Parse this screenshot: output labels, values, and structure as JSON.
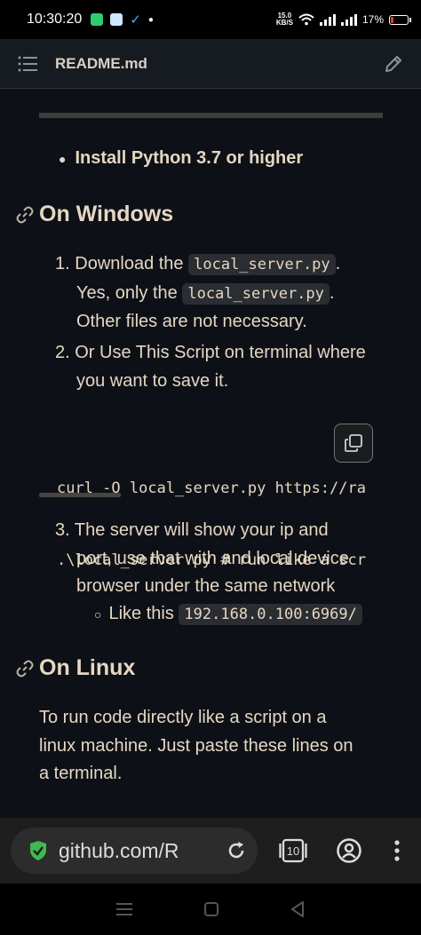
{
  "status": {
    "time": "10:30:20",
    "net_speed_value": "15.0",
    "net_speed_unit": "KB/S",
    "battery": "17%",
    "battery_level": 0.17
  },
  "header": {
    "title": "README.md"
  },
  "content": {
    "bullet_python": "Install Python 3.7 or higher",
    "h_windows": "On Windows",
    "steps": [
      {
        "num": "1.",
        "line1": "Download the",
        "code1": "local_server.py",
        "line1_end": ".",
        "line2": "Yes, only the",
        "code2": "local_server.py",
        "line2_end": ".",
        "line3": "Other files are not necessary."
      },
      {
        "num": "2.",
        "line1": "Or Use This Script on terminal where",
        "line2": "you want to save it."
      },
      {
        "num": "3.",
        "line1": "The server will show your ip and",
        "line2": "port, use that with and local device",
        "line3": "browser under the same network"
      }
    ],
    "code_block_lines": [
      "curl -O local_server.py https://ra",
      ".\\local_server.py # run like a scr"
    ],
    "sub_bullet": "Like this",
    "sub_bullet_code": "192.168.0.100:6969/",
    "h_linux": "On Linux",
    "linux_para": [
      "To run code directly like a script on a",
      "linux machine. Just paste these lines on",
      "a terminal."
    ]
  },
  "browser": {
    "url": "github.com/R",
    "tab_count": "10"
  },
  "colors": {
    "accent_green": "#3fb950",
    "background": "#0d1117",
    "text": "#e6d6c2"
  }
}
